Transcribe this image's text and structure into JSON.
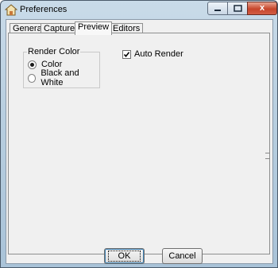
{
  "window": {
    "title": "Preferences"
  },
  "tabs": [
    {
      "label": "General"
    },
    {
      "label": "Capture"
    },
    {
      "label": "Preview"
    },
    {
      "label": "Editors"
    }
  ],
  "preview": {
    "render_color": {
      "label": "Render Color",
      "options": [
        {
          "label": "Color",
          "selected": true
        },
        {
          "label": "Black and White",
          "selected": false
        }
      ]
    },
    "auto_render": {
      "label": "Auto Render",
      "checked": true
    }
  },
  "buttons": {
    "ok": "OK",
    "cancel": "Cancel"
  },
  "titlebar_controls": {
    "close_glyph": "x"
  }
}
